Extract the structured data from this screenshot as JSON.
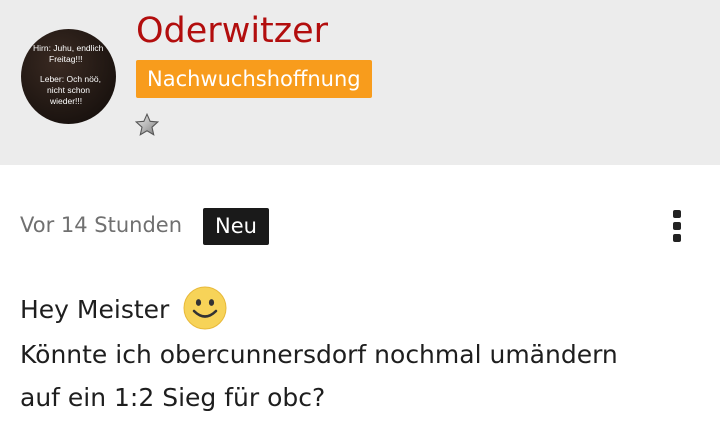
{
  "profile": {
    "username": "Oderwitzer",
    "rank": "Nachwuchshoffnung",
    "avatar_text": [
      "Hirn: Juhu, endlich",
      "Freitag!!!",
      "Leber: Och nöö,",
      "nicht schon",
      "wieder!!!"
    ],
    "rank_icon": "star-icon"
  },
  "post": {
    "timestamp": "Vor 14 Stunden",
    "new_label": "Neu",
    "menu_icon": "more-vertical-icon",
    "lines": [
      "Hey Meister",
      "Könnte ich obercunnersdorf nochmal umändern",
      "auf ein 1:2 Sieg für obc?"
    ],
    "emoji": "smiley-icon"
  },
  "colors": {
    "username": "#b20d0d",
    "rank_badge": "#f89c1c",
    "new_badge": "#1a1a1a",
    "header_bg": "#ececec"
  }
}
